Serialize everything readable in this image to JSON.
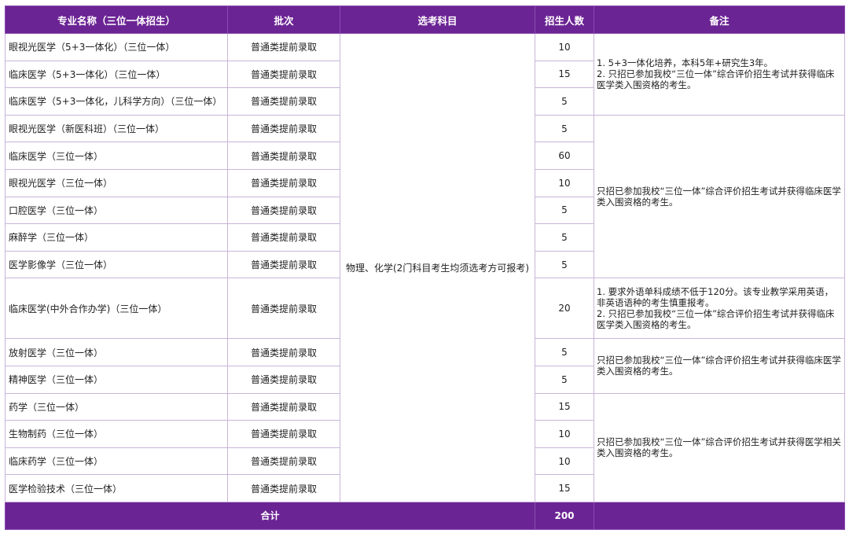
{
  "headers": {
    "major": "专业名称（三位一体招生）",
    "batch": "批次",
    "subject": "选考科目",
    "count": "招生人数",
    "note": "备注"
  },
  "rows": [
    {
      "major": "眼视光医学（5+3一体化）（三位一体）",
      "batch": "普通类提前录取",
      "count": "10"
    },
    {
      "major": "临床医学（5+3一体化）（三位一体）",
      "batch": "普通类提前录取",
      "count": "15"
    },
    {
      "major": "临床医学（5+3一体化，儿科学方向）（三位一体）",
      "batch": "普通类提前录取",
      "count": "5"
    },
    {
      "major": "眼视光医学（新医科班）（三位一体）",
      "batch": "普通类提前录取",
      "count": "5"
    },
    {
      "major": "临床医学（三位一体）",
      "batch": "普通类提前录取",
      "count": "60"
    },
    {
      "major": "眼视光医学（三位一体）",
      "batch": "普通类提前录取",
      "count": "10"
    },
    {
      "major": "口腔医学（三位一体）",
      "batch": "普通类提前录取",
      "count": "5"
    },
    {
      "major": "麻醉学（三位一体）",
      "batch": "普通类提前录取",
      "count": "5"
    },
    {
      "major": "医学影像学（三位一体）",
      "batch": "普通类提前录取",
      "count": "5"
    },
    {
      "major": "临床医学(中外合作办学)（三位一体）",
      "batch": "普通类提前录取",
      "count": "20"
    },
    {
      "major": "放射医学（三位一体）",
      "batch": "普通类提前录取",
      "count": "5"
    },
    {
      "major": "精神医学（三位一体）",
      "batch": "普通类提前录取",
      "count": "5"
    },
    {
      "major": "药学（三位一体）",
      "batch": "普通类提前录取",
      "count": "15"
    },
    {
      "major": "生物制药（三位一体）",
      "batch": "普通类提前录取",
      "count": "10"
    },
    {
      "major": "临床药学（三位一体）",
      "batch": "普通类提前录取",
      "count": "10"
    },
    {
      "major": "医学检验技术（三位一体）",
      "batch": "普通类提前录取",
      "count": "15"
    }
  ],
  "subject_requirement": "物理、化学(2门科目考生均须选考方可报考)",
  "notes": {
    "group1": "1. 5+3一体化培养，本科5年+研究生3年。\n2. 只招已参加我校“三位一体”综合评价招生考试并获得临床医学类入围资格的考生。",
    "group2": "只招已参加我校“三位一体”综合评价招生考试并获得临床医学类入围资格的考生。",
    "group3": "1. 要求外语单科成绩不低于120分。该专业教学采用英语，非英语语种的考生慎重报考。\n2. 只招已参加我校“三位一体”综合评价招生考试并获得临床医学类入围资格的考生。",
    "group4": "只招已参加我校“三位一体”综合评价招生考试并获得临床医学类入围资格的考生。",
    "group5": "只招已参加我校“三位一体”综合评价招生考试并获得医学相关类入围资格的考生。"
  },
  "footer": {
    "total_label": "合计",
    "total_count": "200"
  },
  "colors": {
    "header_bg": "#6b2494",
    "border": "#c9b5d8"
  }
}
